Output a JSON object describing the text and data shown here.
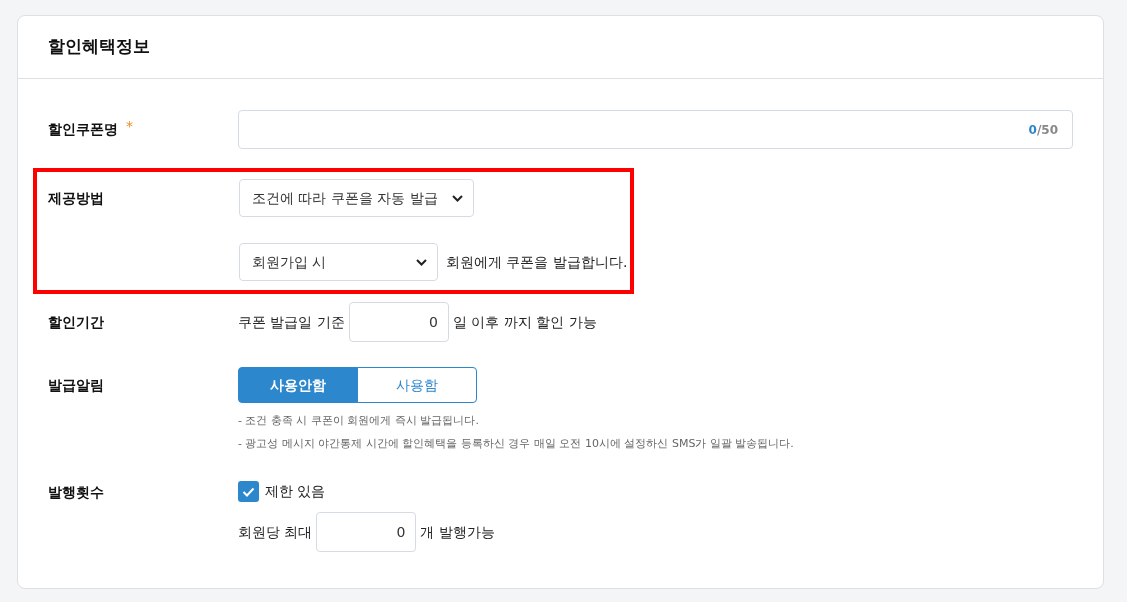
{
  "title": "할인혜택정보",
  "coupon_name": {
    "label": "할인쿠폰명",
    "required_mark": "*",
    "counter_current": "0",
    "counter_max": "/50"
  },
  "method": {
    "label": "제공방법",
    "highlighted": true,
    "select": "조건에 따라 쿠폰을 자동 발급",
    "condition_select": "회원가입 시",
    "suffix": "회원에게 쿠폰을 발급합니다."
  },
  "period": {
    "label": "할인기간",
    "prefix": "쿠폰 발급일 기준",
    "value": "0",
    "suffix": "일 이후 까지 할인 가능"
  },
  "notice": {
    "label": "발급알림",
    "options": [
      {
        "label": "사용안함",
        "selected": true
      },
      {
        "label": "사용함",
        "selected": false
      }
    ],
    "notes": [
      "-  조건 충족 시 쿠폰이 회원에게 즉시 발급됩니다.",
      "-  광고성 메시지 야간통제 시간에 할인혜택을 등록하신 경우 매일 오전 10시에 설정하신 SMS가 일괄 발송됩니다."
    ]
  },
  "count": {
    "label": "발행횟수",
    "limit": {
      "label": "제한 있음",
      "checked": true
    },
    "prefix": "회원당 최대",
    "value": "0",
    "suffix": "개 발행가능"
  }
}
